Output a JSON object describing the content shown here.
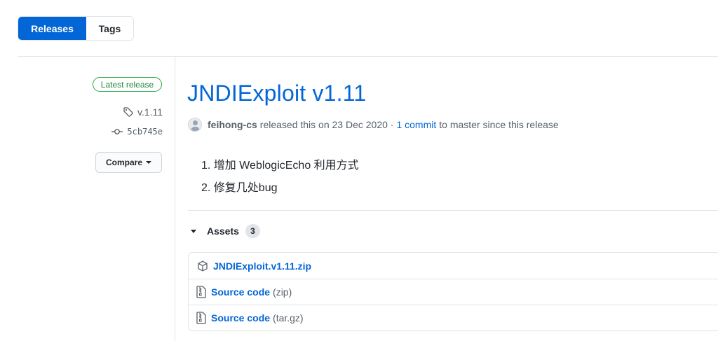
{
  "tabs": [
    {
      "label": "Releases",
      "selected": true
    },
    {
      "label": "Tags",
      "selected": false
    }
  ],
  "sidebar": {
    "badge": "Latest release",
    "tag": "v.1.11",
    "commit": "5cb745e",
    "compare_label": "Compare"
  },
  "release": {
    "title": "JNDIExploit v1.11",
    "author": "feihong-cs",
    "released_text": "released this on 23 Dec 2020 · ",
    "commit_link": "1 commit",
    "since_text": " to master since this release",
    "notes": [
      "增加 WeblogicEcho 利用方式",
      "修复几处bug"
    ]
  },
  "assets": {
    "heading": "Assets",
    "count": "3",
    "items": [
      {
        "name": "JNDIExploit.v1.11.zip",
        "suffix": "",
        "icon": "package-icon"
      },
      {
        "name": "Source code",
        "suffix": "(zip)",
        "icon": "file-zip-icon"
      },
      {
        "name": "Source code",
        "suffix": "(tar.gz)",
        "icon": "file-zip-icon"
      }
    ]
  },
  "colors": {
    "accent": "#0366d6",
    "latest_badge": "#28a745",
    "muted_text": "#586069"
  }
}
